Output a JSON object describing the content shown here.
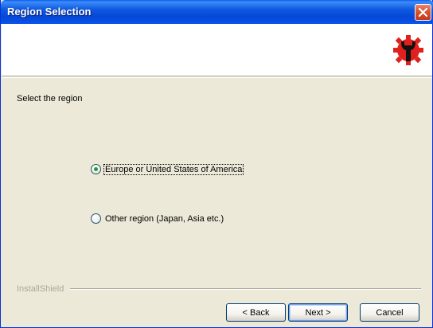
{
  "window": {
    "title": "Region Selection",
    "close_icon": "close-x-icon",
    "logo_icon": "gear-wrench-icon"
  },
  "content": {
    "prompt": "Select the region",
    "options": [
      {
        "label": "Europe or United States of America",
        "selected": true
      },
      {
        "label": "Other region (Japan, Asia etc.)",
        "selected": false
      }
    ]
  },
  "footer": {
    "brand": "InstallShield",
    "buttons": {
      "back": "< Back",
      "next": "Next >",
      "cancel": "Cancel"
    }
  },
  "colors": {
    "titlebar": "#0A52E8",
    "close": "#D8542E",
    "dialog_bg": "#ECE9D8",
    "logo_red": "#E0201C"
  }
}
